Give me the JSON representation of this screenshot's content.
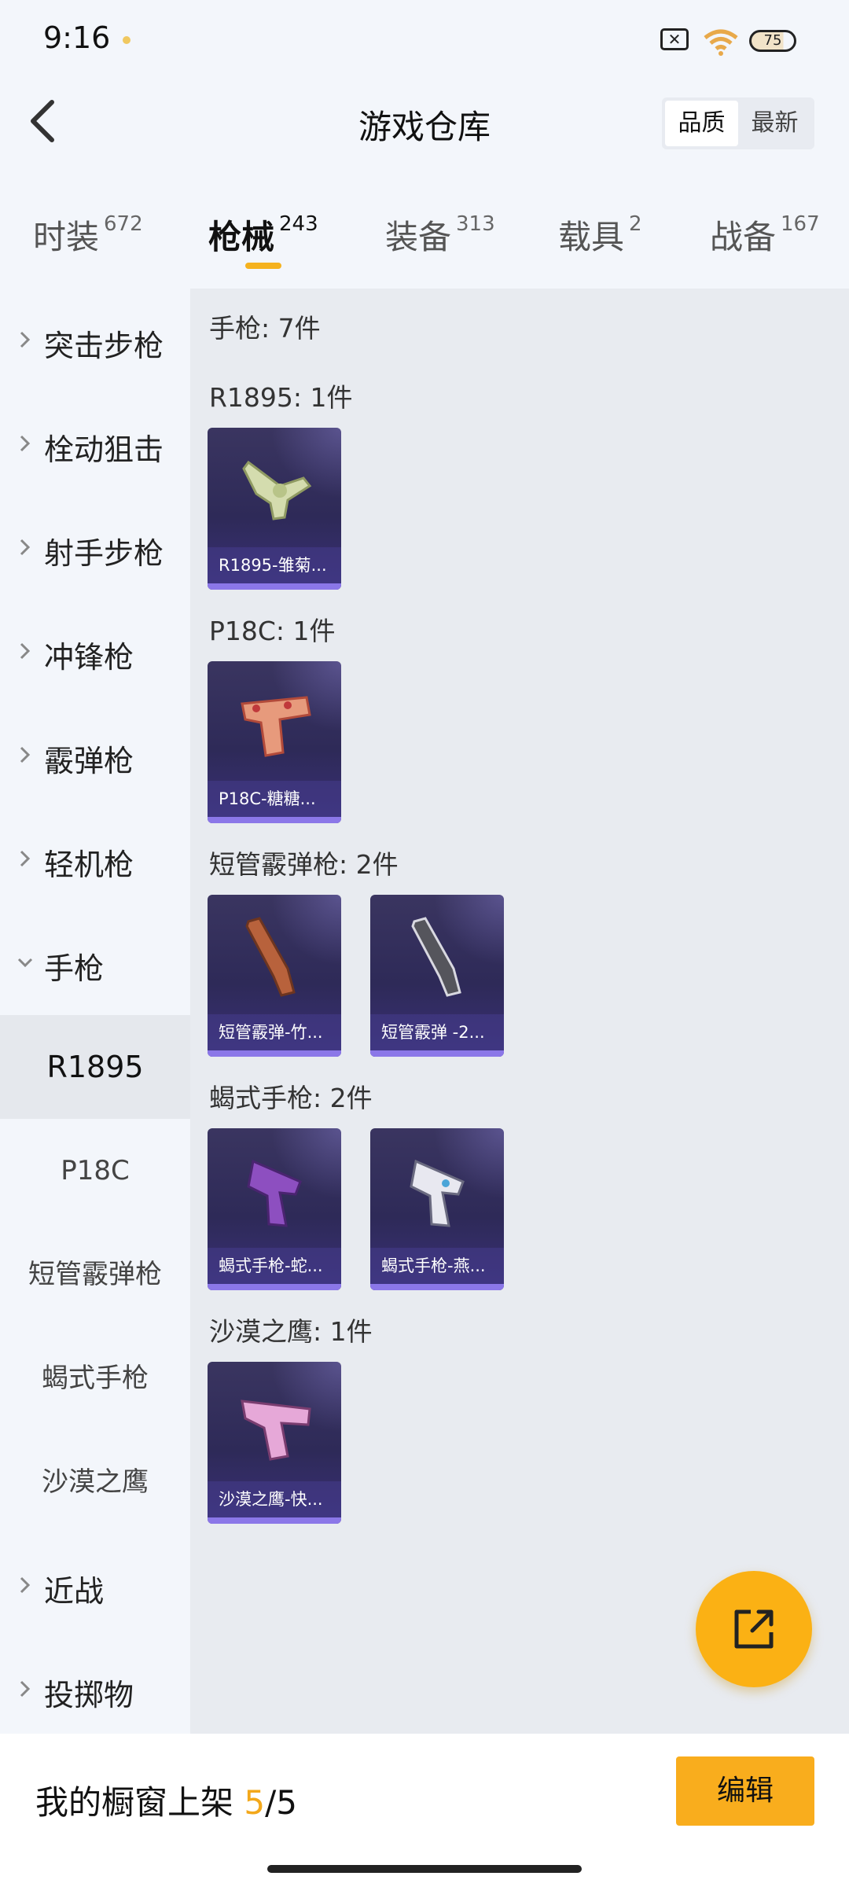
{
  "status": {
    "time": "9:16",
    "battery": "75"
  },
  "header": {
    "title": "游戏仓库",
    "sort": [
      "品质",
      "最新"
    ]
  },
  "tabs": [
    {
      "label": "时装",
      "count": "672"
    },
    {
      "label": "枪械",
      "count": "243"
    },
    {
      "label": "装备",
      "count": "313"
    },
    {
      "label": "载具",
      "count": "2"
    },
    {
      "label": "战备",
      "count": "167"
    }
  ],
  "sidenav": {
    "categories": [
      "突击步枪",
      "栓动狙击",
      "射手步枪",
      "冲锋枪",
      "霰弹枪",
      "轻机枪",
      "手枪"
    ],
    "subs": [
      "R1895",
      "P18C",
      "短管霰弹枪",
      "蝎式手枪",
      "沙漠之鹰"
    ],
    "bottom_categories": [
      "近战",
      "投掷物"
    ]
  },
  "content": {
    "total": "手枪: 7件",
    "groups": [
      {
        "title": "R1895: 1件",
        "items": [
          "R1895-雏菊..."
        ]
      },
      {
        "title": "P18C: 1件",
        "items": [
          "P18C-糖糖..."
        ]
      },
      {
        "title": "短管霰弹枪: 2件",
        "items": [
          "短管霰弹-竹...",
          "短管霰弹 -2..."
        ]
      },
      {
        "title": "蝎式手枪: 2件",
        "items": [
          "蝎式手枪-蛇...",
          "蝎式手枪-燕..."
        ]
      },
      {
        "title": "沙漠之鹰: 1件",
        "items": [
          "沙漠之鹰-快..."
        ]
      }
    ]
  },
  "bottom": {
    "label": "我的橱窗上架 ",
    "current": "5",
    "total": "/5",
    "edit": "编辑"
  },
  "colors": {
    "accent": "#f9ad1d",
    "card_bg": "#2e2a58",
    "card_bar": "#8b77e8"
  },
  "icons": [
    "back-icon",
    "sim-icon",
    "wifi-icon",
    "battery-icon",
    "chevron-right-icon",
    "chevron-down-icon",
    "share-icon"
  ]
}
